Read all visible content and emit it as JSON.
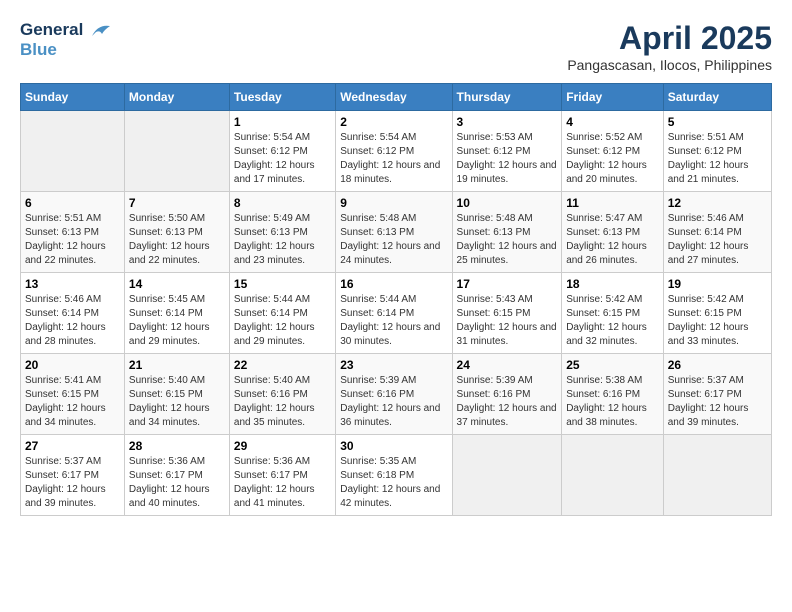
{
  "header": {
    "logo_line1": "General",
    "logo_line2": "Blue",
    "title": "April 2025",
    "subtitle": "Pangascasan, Ilocos, Philippines"
  },
  "days_of_week": [
    "Sunday",
    "Monday",
    "Tuesday",
    "Wednesday",
    "Thursday",
    "Friday",
    "Saturday"
  ],
  "weeks": [
    [
      {
        "day": "",
        "sunrise": "",
        "sunset": "",
        "daylight": ""
      },
      {
        "day": "",
        "sunrise": "",
        "sunset": "",
        "daylight": ""
      },
      {
        "day": "1",
        "sunrise": "Sunrise: 5:54 AM",
        "sunset": "Sunset: 6:12 PM",
        "daylight": "Daylight: 12 hours and 17 minutes."
      },
      {
        "day": "2",
        "sunrise": "Sunrise: 5:54 AM",
        "sunset": "Sunset: 6:12 PM",
        "daylight": "Daylight: 12 hours and 18 minutes."
      },
      {
        "day": "3",
        "sunrise": "Sunrise: 5:53 AM",
        "sunset": "Sunset: 6:12 PM",
        "daylight": "Daylight: 12 hours and 19 minutes."
      },
      {
        "day": "4",
        "sunrise": "Sunrise: 5:52 AM",
        "sunset": "Sunset: 6:12 PM",
        "daylight": "Daylight: 12 hours and 20 minutes."
      },
      {
        "day": "5",
        "sunrise": "Sunrise: 5:51 AM",
        "sunset": "Sunset: 6:12 PM",
        "daylight": "Daylight: 12 hours and 21 minutes."
      }
    ],
    [
      {
        "day": "6",
        "sunrise": "Sunrise: 5:51 AM",
        "sunset": "Sunset: 6:13 PM",
        "daylight": "Daylight: 12 hours and 22 minutes."
      },
      {
        "day": "7",
        "sunrise": "Sunrise: 5:50 AM",
        "sunset": "Sunset: 6:13 PM",
        "daylight": "Daylight: 12 hours and 22 minutes."
      },
      {
        "day": "8",
        "sunrise": "Sunrise: 5:49 AM",
        "sunset": "Sunset: 6:13 PM",
        "daylight": "Daylight: 12 hours and 23 minutes."
      },
      {
        "day": "9",
        "sunrise": "Sunrise: 5:48 AM",
        "sunset": "Sunset: 6:13 PM",
        "daylight": "Daylight: 12 hours and 24 minutes."
      },
      {
        "day": "10",
        "sunrise": "Sunrise: 5:48 AM",
        "sunset": "Sunset: 6:13 PM",
        "daylight": "Daylight: 12 hours and 25 minutes."
      },
      {
        "day": "11",
        "sunrise": "Sunrise: 5:47 AM",
        "sunset": "Sunset: 6:13 PM",
        "daylight": "Daylight: 12 hours and 26 minutes."
      },
      {
        "day": "12",
        "sunrise": "Sunrise: 5:46 AM",
        "sunset": "Sunset: 6:14 PM",
        "daylight": "Daylight: 12 hours and 27 minutes."
      }
    ],
    [
      {
        "day": "13",
        "sunrise": "Sunrise: 5:46 AM",
        "sunset": "Sunset: 6:14 PM",
        "daylight": "Daylight: 12 hours and 28 minutes."
      },
      {
        "day": "14",
        "sunrise": "Sunrise: 5:45 AM",
        "sunset": "Sunset: 6:14 PM",
        "daylight": "Daylight: 12 hours and 29 minutes."
      },
      {
        "day": "15",
        "sunrise": "Sunrise: 5:44 AM",
        "sunset": "Sunset: 6:14 PM",
        "daylight": "Daylight: 12 hours and 29 minutes."
      },
      {
        "day": "16",
        "sunrise": "Sunrise: 5:44 AM",
        "sunset": "Sunset: 6:14 PM",
        "daylight": "Daylight: 12 hours and 30 minutes."
      },
      {
        "day": "17",
        "sunrise": "Sunrise: 5:43 AM",
        "sunset": "Sunset: 6:15 PM",
        "daylight": "Daylight: 12 hours and 31 minutes."
      },
      {
        "day": "18",
        "sunrise": "Sunrise: 5:42 AM",
        "sunset": "Sunset: 6:15 PM",
        "daylight": "Daylight: 12 hours and 32 minutes."
      },
      {
        "day": "19",
        "sunrise": "Sunrise: 5:42 AM",
        "sunset": "Sunset: 6:15 PM",
        "daylight": "Daylight: 12 hours and 33 minutes."
      }
    ],
    [
      {
        "day": "20",
        "sunrise": "Sunrise: 5:41 AM",
        "sunset": "Sunset: 6:15 PM",
        "daylight": "Daylight: 12 hours and 34 minutes."
      },
      {
        "day": "21",
        "sunrise": "Sunrise: 5:40 AM",
        "sunset": "Sunset: 6:15 PM",
        "daylight": "Daylight: 12 hours and 34 minutes."
      },
      {
        "day": "22",
        "sunrise": "Sunrise: 5:40 AM",
        "sunset": "Sunset: 6:16 PM",
        "daylight": "Daylight: 12 hours and 35 minutes."
      },
      {
        "day": "23",
        "sunrise": "Sunrise: 5:39 AM",
        "sunset": "Sunset: 6:16 PM",
        "daylight": "Daylight: 12 hours and 36 minutes."
      },
      {
        "day": "24",
        "sunrise": "Sunrise: 5:39 AM",
        "sunset": "Sunset: 6:16 PM",
        "daylight": "Daylight: 12 hours and 37 minutes."
      },
      {
        "day": "25",
        "sunrise": "Sunrise: 5:38 AM",
        "sunset": "Sunset: 6:16 PM",
        "daylight": "Daylight: 12 hours and 38 minutes."
      },
      {
        "day": "26",
        "sunrise": "Sunrise: 5:37 AM",
        "sunset": "Sunset: 6:17 PM",
        "daylight": "Daylight: 12 hours and 39 minutes."
      }
    ],
    [
      {
        "day": "27",
        "sunrise": "Sunrise: 5:37 AM",
        "sunset": "Sunset: 6:17 PM",
        "daylight": "Daylight: 12 hours and 39 minutes."
      },
      {
        "day": "28",
        "sunrise": "Sunrise: 5:36 AM",
        "sunset": "Sunset: 6:17 PM",
        "daylight": "Daylight: 12 hours and 40 minutes."
      },
      {
        "day": "29",
        "sunrise": "Sunrise: 5:36 AM",
        "sunset": "Sunset: 6:17 PM",
        "daylight": "Daylight: 12 hours and 41 minutes."
      },
      {
        "day": "30",
        "sunrise": "Sunrise: 5:35 AM",
        "sunset": "Sunset: 6:18 PM",
        "daylight": "Daylight: 12 hours and 42 minutes."
      },
      {
        "day": "",
        "sunrise": "",
        "sunset": "",
        "daylight": ""
      },
      {
        "day": "",
        "sunrise": "",
        "sunset": "",
        "daylight": ""
      },
      {
        "day": "",
        "sunrise": "",
        "sunset": "",
        "daylight": ""
      }
    ]
  ]
}
